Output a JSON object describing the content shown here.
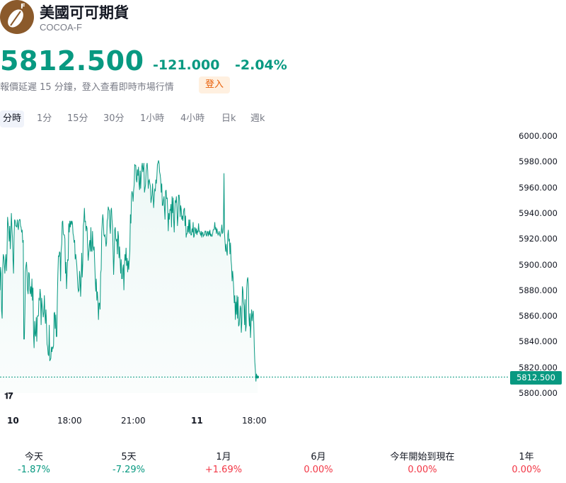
{
  "instrument": {
    "name": "美國可可期貨",
    "ticker": "COCOA-F",
    "logo_badge": "F",
    "logo_icon": "cocoa-bean-icon"
  },
  "quote": {
    "price": "5812.500",
    "change": "-121.000",
    "change_pct": "-2.04%",
    "color": "#089981"
  },
  "notice": {
    "text": "報價延遲 15 分鐘，登入查看即時市場行情",
    "login_label": "登入"
  },
  "tabs": [
    "分時",
    "1分",
    "15分",
    "30分",
    "1小時",
    "4小時",
    "日k",
    "週k"
  ],
  "active_tab": "分時",
  "chart_data": {
    "type": "area",
    "ylim": [
      5800,
      6000
    ],
    "y_ticks": [
      "6000.000",
      "5980.000",
      "5960.000",
      "5940.000",
      "5920.000",
      "5900.000",
      "5880.000",
      "5860.000",
      "5840.000",
      "5820.000",
      "5800.000"
    ],
    "x_ticks": [
      {
        "label": "10",
        "bold": true
      },
      {
        "label": "18:00",
        "bold": false
      },
      {
        "label": "21:00",
        "bold": false
      },
      {
        "label": "11",
        "bold": true
      },
      {
        "label": "18:00",
        "bold": false
      }
    ],
    "last_price_label": "5812.500",
    "last_price": 5812.5,
    "line_color": "#089981",
    "series": [
      {
        "values": [
          5880,
          5898,
          5893,
          5864,
          5858,
          5896,
          5908,
          5906,
          5900,
          5893,
          5903,
          5908,
          5895,
          5909,
          5937,
          5932,
          5928,
          5918,
          5930,
          5912,
          5924,
          5940,
          5929,
          5921,
          5904,
          5893,
          5921,
          5935,
          5934,
          5930,
          5930,
          5929,
          5935,
          5930,
          5927,
          5934,
          5935,
          5935,
          5930,
          5929,
          5925,
          5927,
          5917,
          5919,
          5842,
          5842,
          5862,
          5894,
          5899,
          5902,
          5894,
          5880,
          5877,
          5894,
          5893,
          5881,
          5877,
          5883,
          5875,
          5889,
          5872,
          5882,
          5846,
          5835,
          5856,
          5846,
          5844,
          5859,
          5840,
          5860,
          5860,
          5860,
          5874,
          5872,
          5881,
          5876,
          5853,
          5874,
          5868,
          5864,
          5859,
          5863,
          5876,
          5862,
          5854,
          5865,
          5853,
          5838,
          5836,
          5830,
          5829,
          5853,
          5825,
          5826,
          5827,
          5836,
          5832,
          5836,
          5835,
          5837,
          5862,
          5863,
          5850,
          5861,
          5844,
          5844,
          5874,
          5893,
          5907,
          5906,
          5910,
          5909,
          5887,
          5911,
          5916,
          5933,
          5934,
          5924,
          5923,
          5923,
          5920,
          5893,
          5902,
          5881,
          5894,
          5904,
          5903,
          5932,
          5925,
          5934,
          5929,
          5934,
          5931,
          5934,
          5932,
          5924,
          5922,
          5917,
          5919,
          5904,
          5908,
          5904,
          5899,
          5891,
          5882,
          5879,
          5880,
          5895,
          5890,
          5875,
          5887,
          5909,
          5890,
          5901,
          5930,
          5934,
          5944,
          5933,
          5934,
          5926,
          5930,
          5928,
          5913,
          5903,
          5909,
          5915,
          5919,
          5910,
          5929,
          5911,
          5910,
          5926,
          5914,
          5911,
          5914,
          5902,
          5889,
          5879,
          5889,
          5872,
          5879,
          5872,
          5857,
          5870,
          5870,
          5865,
          5893,
          5896,
          5925,
          5933,
          5939,
          5934,
          5923,
          5922,
          5923,
          5920,
          5914,
          5917,
          5934,
          5936,
          5945,
          5943,
          5942,
          5930,
          5924,
          5942,
          5944,
          5935,
          5930,
          5911,
          5892,
          5906,
          5927,
          5929,
          5920,
          5918,
          5920,
          5908,
          5926,
          5922,
          5905,
          5914,
          5904,
          5893,
          5904,
          5889,
          5889,
          5897,
          5900,
          5880,
          5899,
          5908,
          5903,
          5913,
          5899,
          5905,
          5894,
          5903,
          5896,
          5904,
          5911,
          5939,
          5932,
          5954,
          5957,
          5955,
          5949,
          5958,
          5962,
          5978,
          5977,
          5977,
          5966,
          5964,
          5974,
          5969,
          5976,
          5963,
          5958,
          5973,
          5959,
          5970,
          5976,
          5979,
          5972,
          5975,
          5979,
          5956,
          5959,
          5962,
          5972,
          5977,
          5979,
          5973,
          5959,
          5965,
          5966,
          5963,
          5961,
          5948,
          5951,
          5954,
          5963,
          5953,
          5944,
          5952,
          5959,
          5957,
          5966,
          5963,
          5969,
          5978,
          5979,
          5981,
          5979,
          5972,
          5970,
          5966,
          5956,
          5963,
          5946,
          5946,
          5950,
          5953,
          5943,
          5935,
          5957,
          5958,
          5951,
          5952,
          5942,
          5926,
          5940,
          5935,
          5943,
          5942,
          5947,
          5929,
          5953,
          5940,
          5952,
          5935,
          5925,
          5941,
          5950,
          5948,
          5953,
          5944,
          5930,
          5938,
          5954,
          5954,
          5949,
          5937,
          5946,
          5943,
          5935,
          5938,
          5934,
          5940,
          5943,
          5944,
          5930,
          5938,
          5921,
          5924,
          5924,
          5930,
          5925,
          5935,
          5924,
          5935,
          5926,
          5923,
          5923,
          5928,
          5925,
          5933,
          5921,
          5922,
          5929,
          5928,
          5924,
          5928,
          5923,
          5926,
          5925,
          5932,
          5926,
          5926,
          5924,
          5923,
          5926,
          5921,
          5925,
          5925,
          5922,
          5923,
          5923,
          5926,
          5926,
          5923,
          5922,
          5926,
          5925,
          5922,
          5926,
          5923,
          5927,
          5922,
          5924,
          5922,
          5922,
          5924,
          5927,
          5927,
          5928,
          5933,
          5927,
          5929,
          5924,
          5928,
          5925,
          5923,
          5924,
          5926,
          5923,
          5922,
          5924,
          5926,
          5931,
          5924,
          5925,
          5929,
          5971,
          5924,
          5917,
          5910,
          5916,
          5910,
          5907,
          5923,
          5927,
          5918,
          5920,
          5908,
          5917,
          5904,
          5899,
          5887,
          5895,
          5889,
          5881,
          5870,
          5876,
          5857,
          5871,
          5861,
          5876,
          5858,
          5875,
          5852,
          5853,
          5859,
          5868,
          5866,
          5847,
          5855,
          5883,
          5880,
          5871,
          5868,
          5853,
          5873,
          5848,
          5852,
          5881,
          5888,
          5890,
          5885,
          5860,
          5852,
          5862,
          5843,
          5854,
          5865,
          5856,
          5861,
          5864,
          5855,
          5836,
          5824,
          5818,
          5809,
          5815,
          5813,
          5812.5
        ]
      }
    ]
  },
  "performance": [
    {
      "label": "今天",
      "value": "-1.87%",
      "dir": "neg"
    },
    {
      "label": "5天",
      "value": "-7.29%",
      "dir": "neg"
    },
    {
      "label": "1月",
      "value": "+1.69%",
      "dir": "pos"
    },
    {
      "label": "6月",
      "value": "0.00%",
      "dir": "pos"
    },
    {
      "label": "今年開始到現在",
      "value": "0.00%",
      "dir": "pos"
    },
    {
      "label": "1年",
      "value": "0.00%",
      "dir": "pos"
    }
  ]
}
